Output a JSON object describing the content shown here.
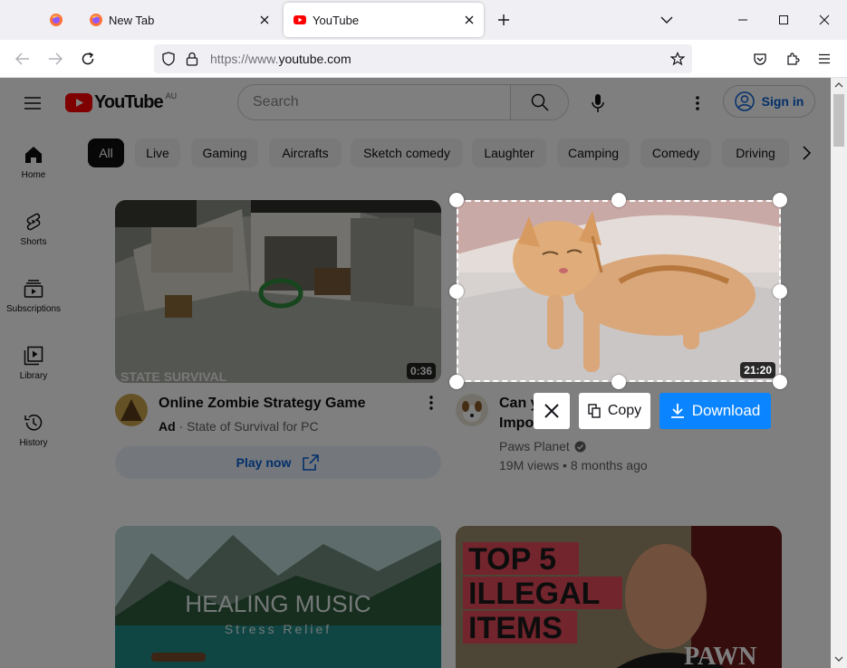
{
  "browser": {
    "tabs": [
      {
        "title": ""
      },
      {
        "title": "New Tab"
      },
      {
        "title": "YouTube"
      }
    ],
    "url_protocol": "https://www.",
    "url_host": "youtube.com"
  },
  "youtube": {
    "logo_text": "YouTube",
    "country_code": "AU",
    "search_placeholder": "Search",
    "sign_in": "Sign in",
    "sidebar": [
      {
        "label": "Home"
      },
      {
        "label": "Shorts"
      },
      {
        "label": "Subscriptions"
      },
      {
        "label": "Library"
      },
      {
        "label": "History"
      }
    ],
    "chips": [
      "All",
      "Live",
      "Gaming",
      "Aircrafts",
      "Sketch comedy",
      "Laughter",
      "Camping",
      "Comedy",
      "Driving"
    ],
    "videos": [
      {
        "title": "Online Zombie Strategy Game",
        "ad_badge": "Ad",
        "channel": "State of Survival for PC",
        "duration": "0:36",
        "cta": "Play now"
      },
      {
        "title_visible": "Can y",
        "title_line2": "Impo",
        "channel": "Paws Planet",
        "views": "19M views",
        "age": "8 months ago",
        "duration": "21:20"
      },
      {
        "thumb_text_1": "HEALING MUSIC",
        "thumb_text_2": "Stress Relief"
      },
      {
        "thumb_text_1": "TOP 5",
        "thumb_text_2": "ILLEGAL",
        "thumb_text_3": "ITEMS",
        "thumb_text_4": "PAWN"
      }
    ]
  },
  "thumb1_text": "STATE SURVIVAL",
  "screenshot_tool": {
    "copy": "Copy",
    "download": "Download"
  },
  "colors": {
    "yt_red": "#ff0000",
    "blue_link": "#065fd4",
    "download_blue": "#0a84ff"
  }
}
